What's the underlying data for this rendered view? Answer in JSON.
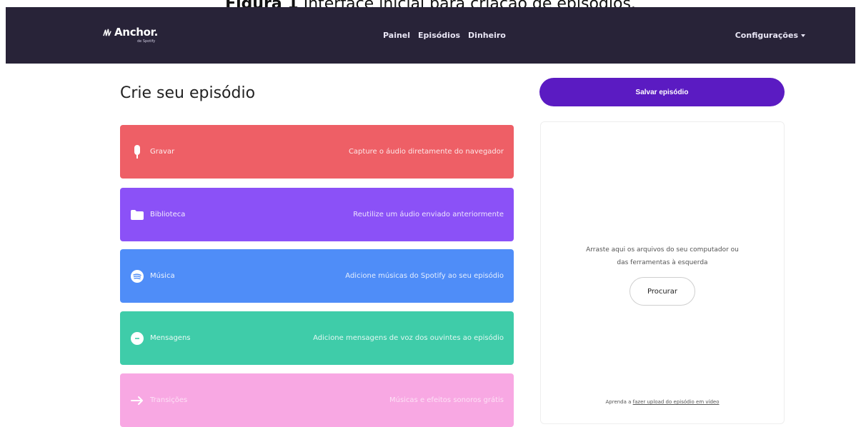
{
  "caption": {
    "bold": "Figura 1",
    "text": " Interface inicial para criação de episódios."
  },
  "brand": {
    "name": "Anchor.",
    "sub": "de Spotify"
  },
  "nav": [
    "Painel",
    "Episódios",
    "Dinheiro"
  ],
  "settings_label": "Configurações",
  "page_title": "Crie seu episódio",
  "tools": [
    {
      "label": "Gravar",
      "desc": "Capture o áudio diretamente do navegador",
      "icon": "microphone-icon"
    },
    {
      "label": "Biblioteca",
      "desc": "Reutilize um áudio enviado anteriormente",
      "icon": "folder-icon"
    },
    {
      "label": "Música",
      "desc": "Adicione músicas do Spotify ao seu episódio",
      "icon": "spotify-icon"
    },
    {
      "label": "Mensagens",
      "desc": "Adicione mensagens de voz dos ouvintes ao episódio",
      "icon": "message-icon"
    },
    {
      "label": "Transições",
      "desc": "Músicas e efeitos sonoros grátis",
      "icon": "arrow-right-icon"
    }
  ],
  "save_label": "Salvar episódio",
  "dropzone": {
    "line1": "Arraste aqui os arquivos do seu computador ou",
    "line2": "das ferramentas à esquerda",
    "browse_label": "Procurar",
    "foot_prefix": "Aprenda a ",
    "foot_link": "fazer upload do episódio em vídeo"
  },
  "colors": {
    "topbar": "#282338",
    "record": "#ee5f66",
    "library": "#8b51f7",
    "music": "#4f8df8",
    "messages": "#3fcca9",
    "transitions": "#f8a8e3",
    "save": "#5b1bc2"
  }
}
